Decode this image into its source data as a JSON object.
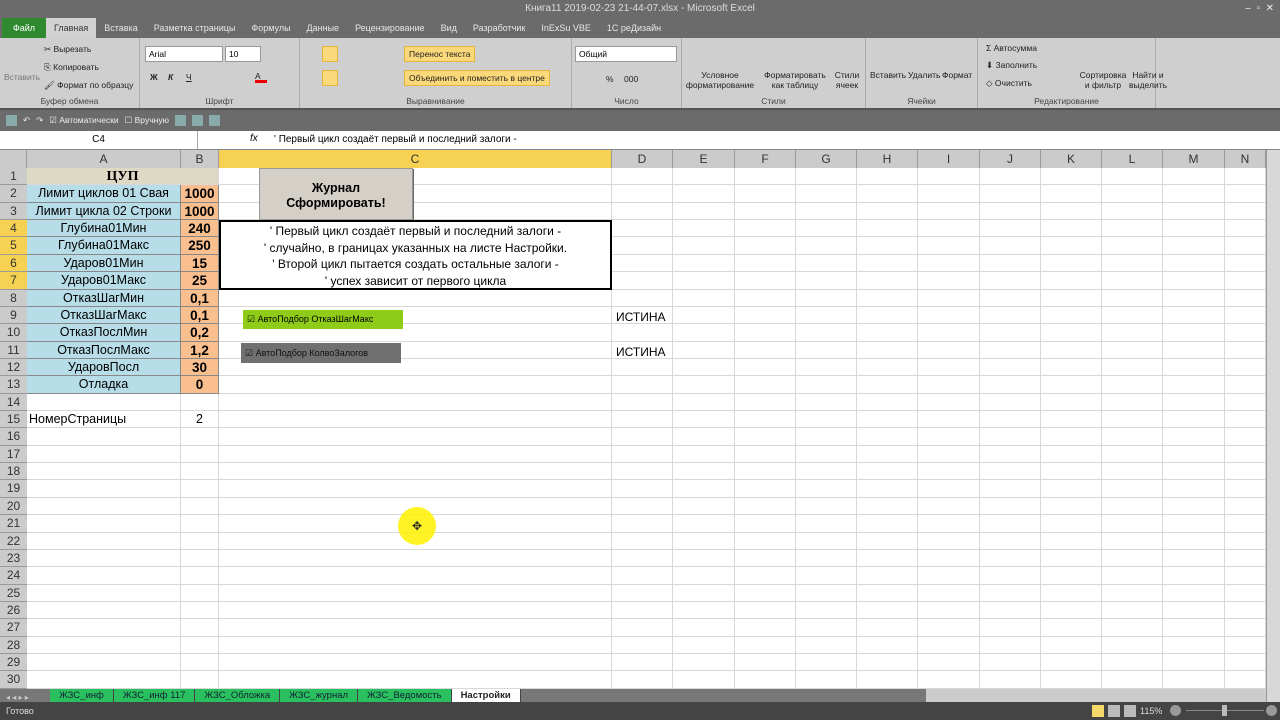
{
  "window": {
    "title": "Книга11 2019-02-23 21-44-07.xlsx  -  Microsoft Excel"
  },
  "ribbon_tabs": [
    "Файл",
    "Главная",
    "Вставка",
    "Разметка страницы",
    "Формулы",
    "Данные",
    "Рецензирование",
    "Вид",
    "Разработчик",
    "InExSu VBE",
    "1С реДизайн"
  ],
  "ribbon": {
    "clipboard": {
      "paste": "Вставить",
      "cut": "Вырезать",
      "copy": "Копировать",
      "format_painter": "Формат по образцу",
      "label": "Буфер обмена"
    },
    "font": {
      "name": "Arial",
      "size": "10",
      "bold": "Ж",
      "italic": "К",
      "underline": "Ч",
      "label": "Шрифт"
    },
    "alignment": {
      "wrap": "Перенос текста",
      "merge": "Объединить и поместить в центре",
      "label": "Выравнивание"
    },
    "number": {
      "format": "Общий",
      "percent": "%",
      "thousands": "000",
      "label": "Число"
    },
    "styles": {
      "conditional": "Условное форматирование",
      "as_table": "Форматировать как таблицу",
      "cell_styles": "Стили ячеек",
      "label": "Стили"
    },
    "cells": {
      "insert": "Вставить",
      "delete": "Удалить",
      "format": "Формат",
      "label": "Ячейки"
    },
    "editing": {
      "autosum": "Автосумма",
      "fill": "Заполнить",
      "clear": "Очистить",
      "sort": "Сортировка и фильтр",
      "find": "Найти и выделить",
      "label": "Редактирование"
    }
  },
  "qat": {
    "auto": "Автоматически",
    "manual": "Вручную"
  },
  "formula_bar": {
    "name_box": "C4",
    "fx": "fx",
    "formula": "' Первый цикл создаёт первый и последний залоги -"
  },
  "columns": [
    "A",
    "B",
    "C",
    "D",
    "E",
    "F",
    "G",
    "H",
    "I",
    "J",
    "K",
    "L",
    "M",
    "N"
  ],
  "selected_column": "C",
  "rows": [
    {
      "a": "ЦУП",
      "b": ""
    },
    {
      "a": "Лимит циклов 01 Свая",
      "b": "1000"
    },
    {
      "a": "Лимит цикла 02 Строки",
      "b": "1000"
    },
    {
      "a": "Глубина01Мин",
      "b": "240"
    },
    {
      "a": "Глубина01Макс",
      "b": "250"
    },
    {
      "a": "Ударов01Мин",
      "b": "15"
    },
    {
      "a": "Ударов01Макс",
      "b": "25"
    },
    {
      "a": "ОтказШагМин",
      "b": "0,1"
    },
    {
      "a": "ОтказШагМакс",
      "b": "0,1"
    },
    {
      "a": "ОтказПослМин",
      "b": "0,2"
    },
    {
      "a": "ОтказПослМакс",
      "b": "1,2"
    },
    {
      "a": "УдаровПосл",
      "b": "30"
    },
    {
      "a": "Отладка",
      "b": "0"
    },
    {
      "a": "",
      "b": ""
    },
    {
      "a": "НомерСтраницы",
      "b": "2"
    }
  ],
  "row_count": 31,
  "button": {
    "line1": "Журнал",
    "line2": "Сформировать!"
  },
  "note": [
    "' Первый цикл создаёт первый и последний залоги -",
    "' случайно, в границах указанных на листе Настройки.",
    "' Второй цикл пытается создать остальные залоги -",
    "' успех зависит от первого цикла"
  ],
  "checkboxes": [
    {
      "label": "АвтоПодбор  ОтказШагМакс",
      "checked": true,
      "value": "ИСТИНА",
      "color": "#8fcc1a"
    },
    {
      "label": "АвтоПодбор  КолвоЗалогов",
      "checked": true,
      "value": "ИСТИНА",
      "color": "#707070"
    }
  ],
  "sheets": [
    "ЖЗС_инф",
    "ЖЗС_инф 117",
    "ЖЗС_Обложка",
    "ЖЗС_журнал",
    "ЖЗС_Ведомость",
    "Настройки"
  ],
  "active_sheet": "Настройки",
  "status": {
    "ready": "Готово",
    "zoom": "115%"
  }
}
